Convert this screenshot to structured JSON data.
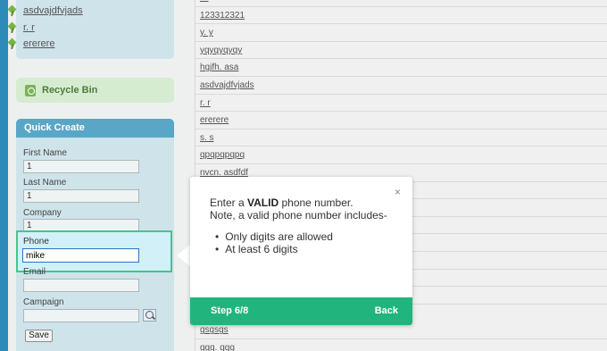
{
  "sidebar": {
    "recent_items": [
      {
        "label": "asdvajdfvjads",
        "icon": "pin-icon"
      },
      {
        "label": "r. r",
        "icon": "pin-icon"
      },
      {
        "label": "ererere",
        "icon": "pin-icon"
      }
    ],
    "recycle_bin": {
      "label": "Recycle Bin",
      "icon": "recycle-bin-icon"
    }
  },
  "quick_create": {
    "title": "Quick Create",
    "fields": {
      "first_name": {
        "label": "First Name",
        "value": "1"
      },
      "last_name": {
        "label": "Last Name",
        "value": "1"
      },
      "company": {
        "label": "Company",
        "value": "1"
      },
      "phone": {
        "label": "Phone",
        "value": "mike"
      },
      "email": {
        "label": "Email",
        "value": ""
      },
      "campaign": {
        "label": "Campaign",
        "value": ""
      }
    },
    "save_label": "Save"
  },
  "list": {
    "rows": [
      "r r",
      "123312321",
      "y. y",
      "yqyqyqyqy",
      "hgjfh. asa",
      "asdvajdfvjads",
      "r. r",
      "ererere",
      "s. s",
      "qpqpqpqpq",
      "nvcn. asdfdf",
      "",
      "",
      "",
      "",
      "",
      "",
      "",
      "gsgsgs",
      "ggg. ggg"
    ]
  },
  "tour_popup": {
    "line1_pre": "Enter a ",
    "line1_bold": "VALID",
    "line1_post": " phone number.",
    "line2": "Note, a valid phone number includes-",
    "bullets": [
      "Only digits are allowed",
      "At least 6 digits"
    ],
    "close_symbol": "×",
    "step_label": "Step 6/8",
    "back_label": "Back"
  },
  "colors": {
    "accent": "#2e8ab8",
    "quick_create_header": "#5aa6c6",
    "panel": "#cfe3ea",
    "highlight_border": "#3cc98e",
    "tour_footer": "#21b57d"
  }
}
